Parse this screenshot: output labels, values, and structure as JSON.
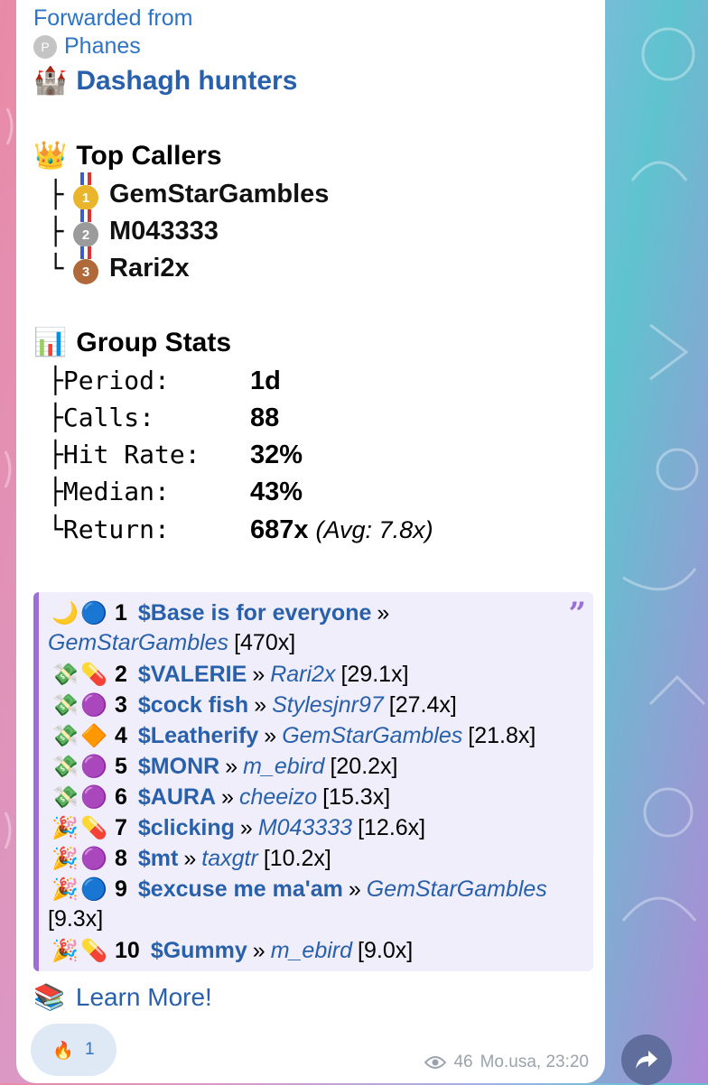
{
  "forward": {
    "label": "Forwarded from",
    "source": "Phanes",
    "avatar_letter": "P"
  },
  "channel": {
    "emoji": "🏰",
    "name": "Dashagh hunters"
  },
  "top_callers": {
    "emoji": "👑",
    "title": "Top Callers",
    "items": [
      {
        "branch": "├",
        "medal": "1",
        "name": "GemStarGambles"
      },
      {
        "branch": "├",
        "medal": "2",
        "name": "M043333"
      },
      {
        "branch": "└",
        "medal": "3",
        "name": "Rari2x"
      }
    ]
  },
  "group_stats": {
    "emoji": "📊",
    "title": "Group Stats",
    "rows": [
      {
        "key": "├Period:",
        "value": "1d"
      },
      {
        "key": "├Calls:",
        "value": "88"
      },
      {
        "key": "├Hit Rate:",
        "value": "32%"
      },
      {
        "key": "├Median:",
        "value": "43%"
      },
      {
        "key": "└Return:",
        "value": "687x",
        "note": "(Avg: 7.8x)"
      }
    ]
  },
  "quote": {
    "mark": "”",
    "entries": [
      {
        "icon1": "🌙",
        "icon2": "🔵",
        "rank": "1",
        "symbol": "$Base is for everyone",
        "sep": "»",
        "user": "GemStarGambles",
        "mult": "[470x]"
      },
      {
        "icon1": "💸",
        "icon2": "💊",
        "rank": "2",
        "symbol": "$VALERIE ",
        "sep": "»",
        "user": "Rari2x",
        "mult": "[29.1x]"
      },
      {
        "icon1": "💸",
        "icon2": "🟣",
        "rank": "3",
        "symbol": "$cock fish",
        "sep": "»",
        "user": "Stylesjnr97",
        "mult": "[27.4x]"
      },
      {
        "icon1": "💸",
        "icon2": "🔶",
        "rank": "4",
        "symbol": "$Leatherify",
        "sep": "»",
        "user": "GemStarGambles",
        "mult": "[21.8x]"
      },
      {
        "icon1": "💸",
        "icon2": "🟣",
        "rank": "5",
        "symbol": "$MONR",
        "sep": "»",
        "user": "m_ebird",
        "mult": "[20.2x]"
      },
      {
        "icon1": "💸",
        "icon2": "🟣",
        "rank": "6",
        "symbol": "$AURA",
        "sep": "»",
        "user": "cheeizo",
        "mult": "[15.3x]"
      },
      {
        "icon1": "🎉",
        "icon2": "💊",
        "rank": "7",
        "symbol": "$clicking",
        "sep": "»",
        "user": "M043333",
        "mult": "[12.6x]"
      },
      {
        "icon1": "🎉",
        "icon2": "🟣",
        "rank": "8",
        "symbol": "$mt",
        "sep": "»",
        "user": "taxgtr",
        "mult": "[10.2x]"
      },
      {
        "icon1": "🎉",
        "icon2": "🔵",
        "rank": "9",
        "symbol": "$excuse me ma'am",
        "sep": "»",
        "user": "GemStarGambles",
        "mult": "[9.3x]"
      },
      {
        "icon1": "🎉",
        "icon2": "💊",
        "rank": "10",
        "symbol": "$Gummy",
        "sep": "»",
        "user": "m_ebird",
        "mult": "[9.0x]"
      }
    ]
  },
  "learn_more": {
    "emoji": "📚",
    "label": "Learn More!"
  },
  "reaction": {
    "emoji": "🔥",
    "count": "1"
  },
  "meta": {
    "views": "46",
    "author": "Mo.usa",
    "time": "23:20"
  },
  "icons": {
    "views": "eye-icon",
    "share": "share-arrow-icon"
  }
}
